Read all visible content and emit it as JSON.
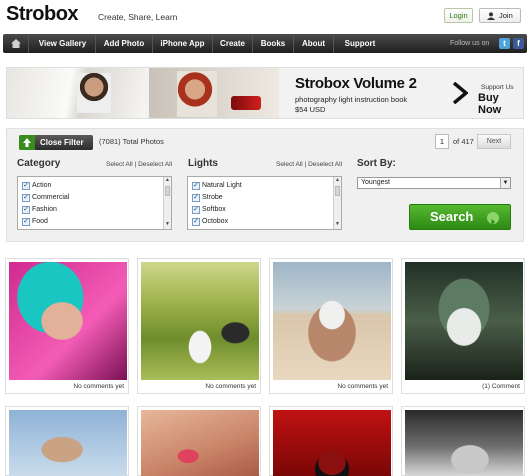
{
  "header": {
    "logo": "Strobox",
    "tagline": "Create, Share, Learn",
    "login_label": "Login",
    "join_label": "Join"
  },
  "nav": {
    "items": [
      "View Gallery",
      "Add Photo",
      "iPhone App",
      "Create",
      "Books",
      "About",
      "Support"
    ],
    "follow_text": "Follow us on"
  },
  "banner": {
    "title": "Strobox Volume 2",
    "subtitle": "photography light instruction book",
    "price": "$54 USD",
    "support_text": "Support Us",
    "buy_text": "Buy Now"
  },
  "filter": {
    "close_label": "Close Filter",
    "total_text": "(7081) Total Photos",
    "page_current": "1",
    "page_of": "of 417",
    "next_label": "Next",
    "category": {
      "title": "Category",
      "select_all": "Select All",
      "deselect_all": "Deselect All",
      "items": [
        "Action",
        "Commercial",
        "Fashion",
        "Food"
      ]
    },
    "lights": {
      "title": "Lights",
      "select_all": "Select All",
      "deselect_all": "Deselect All",
      "items": [
        "Natural Light",
        "Strobe",
        "Softbox",
        "Octobox"
      ]
    },
    "sort": {
      "title": "Sort By:",
      "selected": "Youngest"
    },
    "search_label": "Search"
  },
  "gallery": {
    "row1": [
      {
        "comment": "No comments yet",
        "icon": "portrait-teal-hair"
      },
      {
        "comment": "No comments yet",
        "icon": "wedding-couple"
      },
      {
        "comment": "No comments yet",
        "icon": "woman-meditating"
      },
      {
        "comment": "(1) Comment",
        "icon": "woman-forest"
      }
    ]
  },
  "colors": {
    "accent_green": "#3a9a1c",
    "nav_dark": "#2b2b2b"
  }
}
